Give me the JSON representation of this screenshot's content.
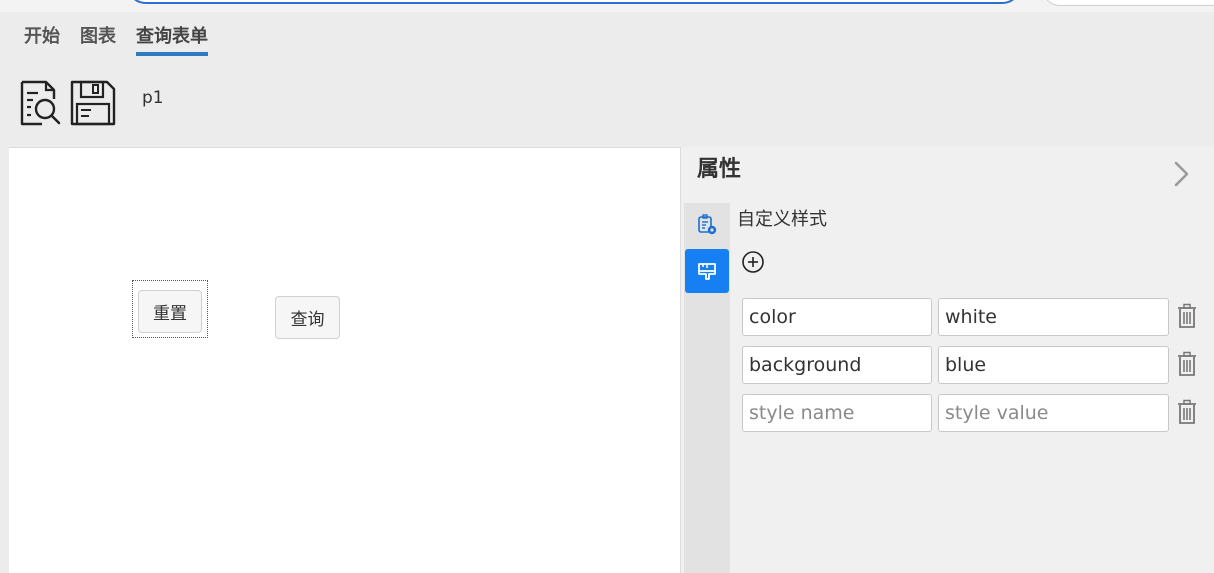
{
  "tabs": [
    {
      "label": "开始"
    },
    {
      "label": "图表"
    },
    {
      "label": "查询表单",
      "active": true
    }
  ],
  "toolbar": {
    "preview_icon": "search-document-icon",
    "save_icon": "floppy-disk-icon",
    "page_name": "p1"
  },
  "canvas": {
    "reset_button": "重置",
    "query_button": "查询"
  },
  "properties": {
    "title": "属性",
    "collapse_icon": "chevron-right-icon",
    "side_tabs": [
      {
        "icon": "component-settings-icon",
        "active": false
      },
      {
        "icon": "paint-brush-icon",
        "active": true
      }
    ],
    "section_title": "自定义样式",
    "add_icon": "plus-circle-icon",
    "styles": [
      {
        "name": "color",
        "value": "white"
      },
      {
        "name": "background",
        "value": "blue"
      },
      {
        "name": "",
        "value": "",
        "name_placeholder": "style name",
        "value_placeholder": "style value"
      }
    ],
    "delete_icon": "trash-icon"
  },
  "colors": {
    "accent": "#2f78c2",
    "active_side_tab": "#1680f2"
  }
}
